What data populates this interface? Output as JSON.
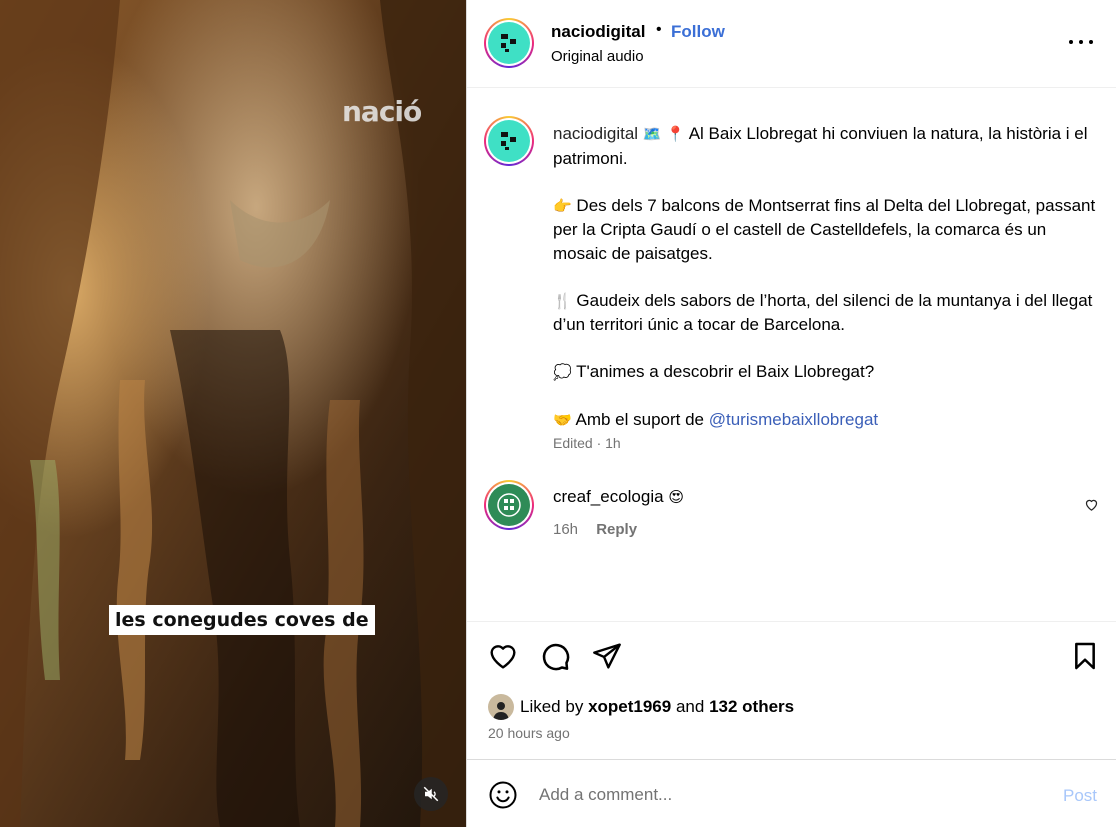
{
  "media": {
    "watermark": "nació",
    "subtitle": "les conegudes coves de",
    "mute_icon": "speaker-muted-icon"
  },
  "header": {
    "username": "naciodigital",
    "separator": "•",
    "follow_label": "Follow",
    "audio_label": "Original audio",
    "more_icon": "more-options-icon"
  },
  "caption": {
    "username": "naciodigital",
    "paragraphs": [
      {
        "emoji": "🗺️ 📍",
        "text": "Al Baix Llobregat hi conviuen la natura, la història i el patrimoni."
      },
      {
        "emoji": "👉",
        "text": "Des dels 7 balcons de Montserrat fins al Delta del Llobregat, passant per la Cripta Gaudí o el castell de Castelldefels, la comarca és un mosaic de paisatges."
      },
      {
        "emoji": "🍴",
        "text": "Gaudeix dels sabors de l’horta, del silenci de la muntanya i del llegat d’un territori únic a tocar de Barcelona."
      },
      {
        "emoji": "💭",
        "text": "T'animes a descobrir el Baix Llobregat?"
      },
      {
        "emoji": "🤝",
        "text": "Amb el suport de",
        "mention": "@turismebaixllobregat"
      }
    ],
    "edited": "Edited · 1h"
  },
  "comment": {
    "username": "creaf_ecologia",
    "emoji": "😍",
    "time": "16h",
    "reply_label": "Reply"
  },
  "likes": {
    "prefix": "Liked by",
    "user": "xopet1969",
    "and": "and",
    "others": "132 others",
    "time_ago": "20 hours ago"
  },
  "composer": {
    "placeholder": "Add a comment...",
    "post_label": "Post"
  },
  "colors": {
    "link": "#3b6fd6",
    "muted": "#737373",
    "post_disabled": "#a8c7fa",
    "avatar_bg": "#3fe0c5"
  }
}
